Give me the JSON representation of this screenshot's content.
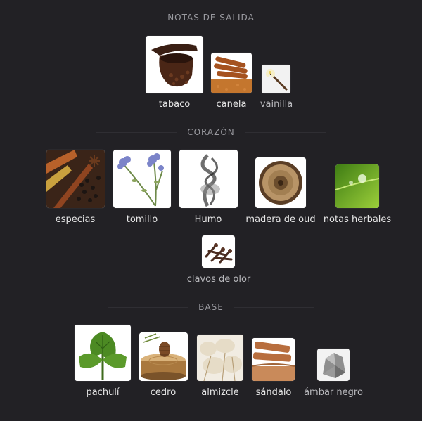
{
  "sections": {
    "top": {
      "title": "NOTAS DE SALIDA",
      "notes": [
        {
          "label": "tabaco",
          "icon": "tobacco-pipe-icon"
        },
        {
          "label": "canela",
          "icon": "cinnamon-icon"
        },
        {
          "label": "vainilla",
          "icon": "vanilla-flower-icon"
        }
      ]
    },
    "heart": {
      "title": "CORAZÓN",
      "notes": [
        {
          "label": "especias",
          "icon": "spices-icon"
        },
        {
          "label": "tomillo",
          "icon": "thyme-icon"
        },
        {
          "label": "Humo",
          "icon": "smoke-icon"
        },
        {
          "label": "madera de oud",
          "icon": "oud-wood-icon"
        },
        {
          "label": "notas herbales",
          "icon": "herbal-leaf-icon"
        },
        {
          "label": "clavos de olor",
          "icon": "cloves-icon"
        }
      ]
    },
    "base": {
      "title": "BASE",
      "notes": [
        {
          "label": "pachulí",
          "icon": "patchouli-leaf-icon"
        },
        {
          "label": "cedro",
          "icon": "cedar-icon"
        },
        {
          "label": "almizcle",
          "icon": "musk-icon"
        },
        {
          "label": "sándalo",
          "icon": "sandalwood-icon"
        },
        {
          "label": "ámbar negro",
          "icon": "black-amber-stone-icon"
        }
      ]
    }
  }
}
